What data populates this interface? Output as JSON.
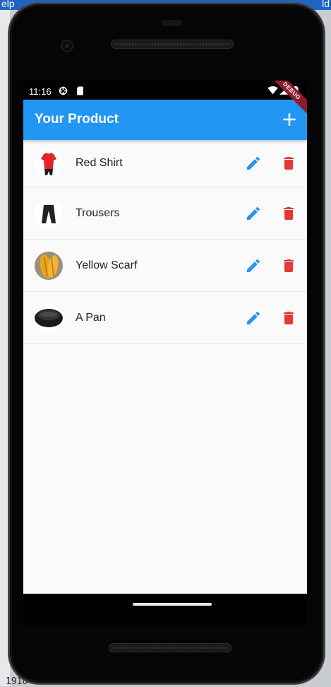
{
  "desktop": {
    "top_left_text": "elp",
    "top_right_text": "ld",
    "bottom_text": "1910"
  },
  "status_bar": {
    "time": "11:16",
    "icons": [
      "settings-gear-icon",
      "sd-card-icon",
      "wifi-icon",
      "signal-icon",
      "battery-icon"
    ]
  },
  "app_bar": {
    "title": "Your Product",
    "action_icon": "plus-icon",
    "color": "#2196f3"
  },
  "debug_banner": "DEBUG",
  "products": [
    {
      "title": "Red Shirt",
      "thumbnail": "red-shirt"
    },
    {
      "title": "Trousers",
      "thumbnail": "trousers"
    },
    {
      "title": "Yellow Scarf",
      "thumbnail": "yellow-scarf"
    },
    {
      "title": "A Pan",
      "thumbnail": "pan"
    }
  ],
  "colors": {
    "edit_icon": "#2196f3",
    "delete_icon": "#e53935",
    "background": "#fafafa"
  }
}
